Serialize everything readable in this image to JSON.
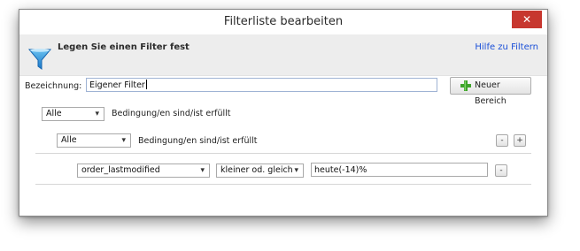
{
  "window": {
    "title": "Filterliste bearbeiten",
    "close_symbol": "✕"
  },
  "header": {
    "title": "Legen Sie einen Filter fest",
    "help_link": "Hilfe zu Filtern"
  },
  "name": {
    "label": "Bezeichnung:",
    "value": "Eigener Filter"
  },
  "new_range_button": {
    "label": "Neuer Bereich"
  },
  "group1": {
    "mode": "Alle",
    "condition_text": "Bedingung/en sind/ist erfüllt"
  },
  "group2": {
    "mode": "Alle",
    "condition_text": "Bedingung/en sind/ist erfüllt",
    "minus_label": "-",
    "plus_label": "+"
  },
  "condition": {
    "field": "order_lastmodified",
    "operator": "kleiner od. gleich",
    "value": "heute(-14)%",
    "minus_label": "-"
  },
  "icons": {
    "filter": "filter-funnel-icon",
    "add": "green-plus-icon",
    "dropdown": "chevron-down-icon"
  },
  "colors": {
    "link": "#1a4fd8",
    "close": "#c7372f",
    "header_bg": "#ededed"
  }
}
